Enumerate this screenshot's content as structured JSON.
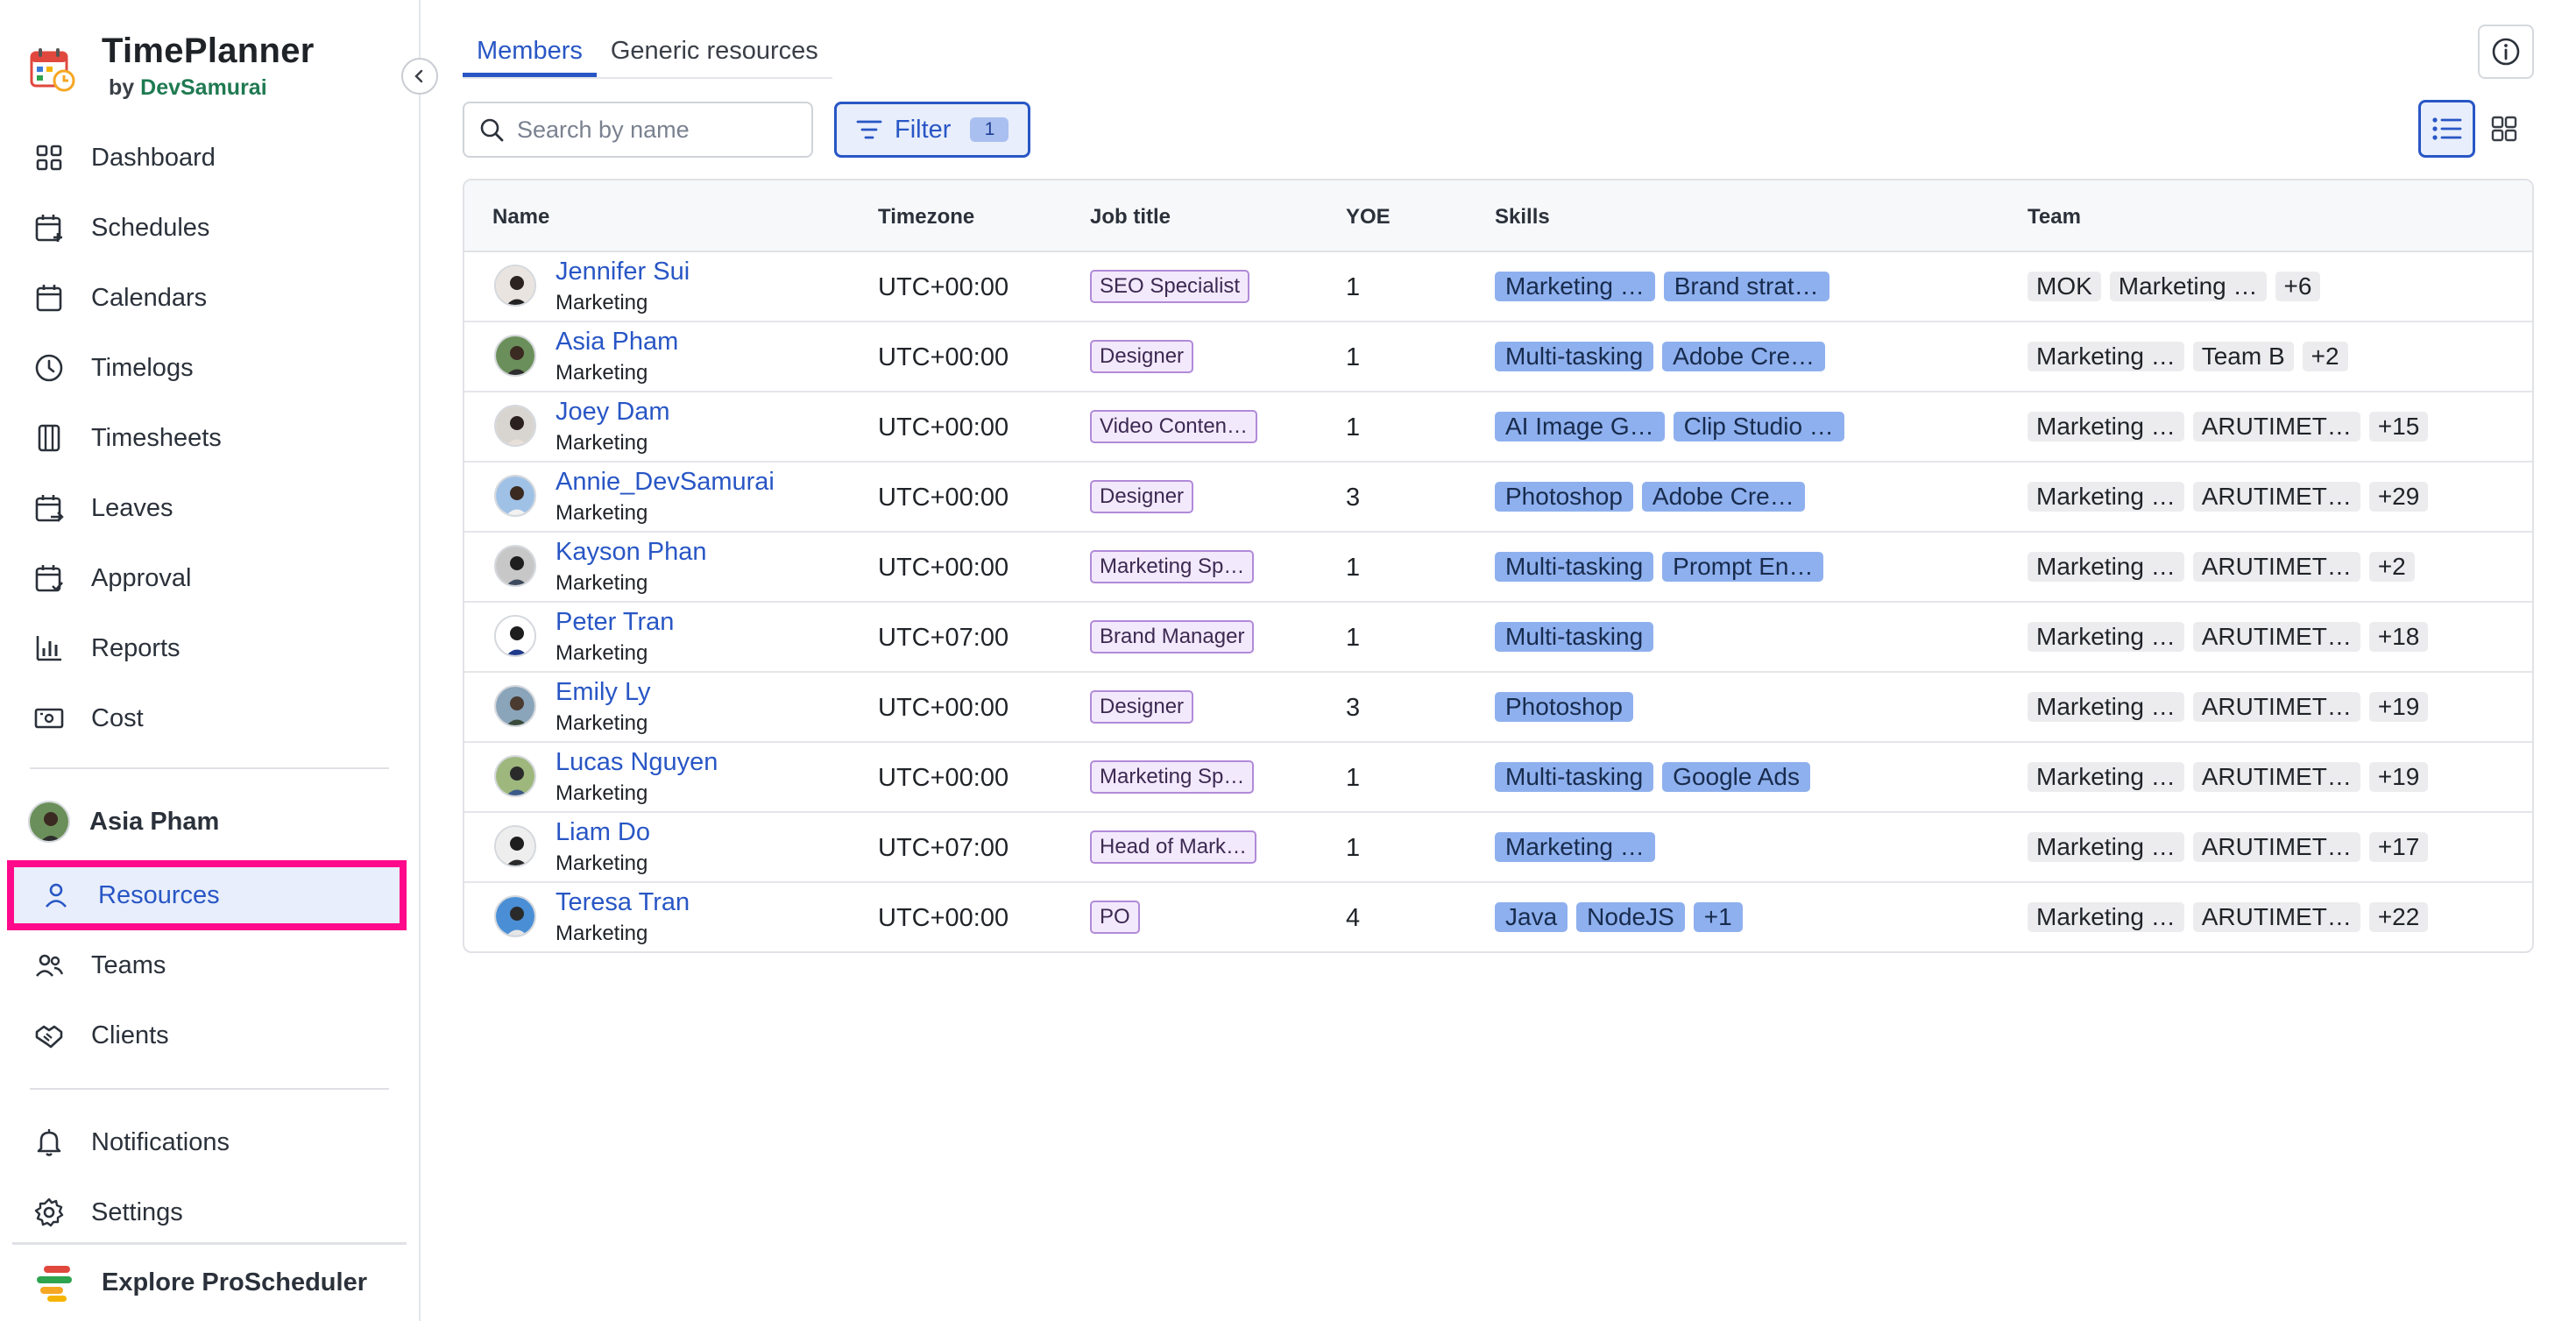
{
  "app": {
    "title": "TimePlanner",
    "by": "by",
    "vendor": "DevSamurai"
  },
  "sidebar": {
    "items": [
      {
        "label": "Dashboard",
        "icon": "dashboard-icon"
      },
      {
        "label": "Schedules",
        "icon": "calendar-plus-icon"
      },
      {
        "label": "Calendars",
        "icon": "calendar-icon"
      },
      {
        "label": "Timelogs",
        "icon": "clock-icon"
      },
      {
        "label": "Timesheets",
        "icon": "timesheet-icon"
      },
      {
        "label": "Leaves",
        "icon": "calendar-leave-icon"
      },
      {
        "label": "Approval",
        "icon": "calendar-check-icon"
      },
      {
        "label": "Reports",
        "icon": "bar-chart-icon"
      },
      {
        "label": "Cost",
        "icon": "money-icon"
      }
    ],
    "user_name": "Asia Pham",
    "items2": [
      {
        "label": "Resources",
        "icon": "person-icon",
        "active": true
      },
      {
        "label": "Teams",
        "icon": "people-icon"
      },
      {
        "label": "Clients",
        "icon": "handshake-icon"
      }
    ],
    "items3": [
      {
        "label": "Notifications",
        "icon": "bell-icon"
      },
      {
        "label": "Settings",
        "icon": "gear-icon"
      }
    ],
    "explore_label": "Explore ProScheduler"
  },
  "tabs": [
    {
      "label": "Members",
      "active": true
    },
    {
      "label": "Generic resources",
      "active": false
    }
  ],
  "search": {
    "placeholder": "Search by name"
  },
  "filter": {
    "label": "Filter",
    "count": "1"
  },
  "table": {
    "headers": {
      "name": "Name",
      "timezone": "Timezone",
      "job": "Job title",
      "yoe": "YOE",
      "skills": "Skills",
      "team": "Team"
    },
    "rows": [
      {
        "name": "Jennifer Sui",
        "dept": "Marketing",
        "tz": "UTC+00:00",
        "job": "SEO Specialist",
        "yoe": "1",
        "skills": [
          "Marketing …",
          "Brand strat…"
        ],
        "teams": [
          "MOK",
          "Marketing …",
          "+6"
        ]
      },
      {
        "name": "Asia Pham",
        "dept": "Marketing",
        "tz": "UTC+00:00",
        "job": "Designer",
        "yoe": "1",
        "skills": [
          "Multi-tasking",
          "Adobe Cre…"
        ],
        "teams": [
          "Marketing …",
          "Team B",
          "+2"
        ]
      },
      {
        "name": "Joey Dam",
        "dept": "Marketing",
        "tz": "UTC+00:00",
        "job": "Video Conten…",
        "yoe": "1",
        "skills": [
          "AI Image G…",
          "Clip Studio …"
        ],
        "teams": [
          "Marketing …",
          "ARUTIMET…",
          "+15"
        ]
      },
      {
        "name": "Annie_DevSamurai",
        "dept": "Marketing",
        "tz": "UTC+00:00",
        "job": "Designer",
        "yoe": "3",
        "skills": [
          "Photoshop",
          "Adobe Cre…"
        ],
        "teams": [
          "Marketing …",
          "ARUTIMET…",
          "+29"
        ]
      },
      {
        "name": "Kayson Phan",
        "dept": "Marketing",
        "tz": "UTC+00:00",
        "job": "Marketing Sp…",
        "yoe": "1",
        "skills": [
          "Multi-tasking",
          "Prompt En…"
        ],
        "teams": [
          "Marketing …",
          "ARUTIMET…",
          "+2"
        ]
      },
      {
        "name": "Peter Tran",
        "dept": "Marketing",
        "tz": "UTC+07:00",
        "job": "Brand Manager",
        "yoe": "1",
        "skills": [
          "Multi-tasking"
        ],
        "teams": [
          "Marketing …",
          "ARUTIMET…",
          "+18"
        ]
      },
      {
        "name": "Emily Ly",
        "dept": "Marketing",
        "tz": "UTC+00:00",
        "job": "Designer",
        "yoe": "3",
        "skills": [
          "Photoshop"
        ],
        "teams": [
          "Marketing …",
          "ARUTIMET…",
          "+19"
        ]
      },
      {
        "name": "Lucas Nguyen",
        "dept": "Marketing",
        "tz": "UTC+00:00",
        "job": "Marketing Sp…",
        "yoe": "1",
        "skills": [
          "Multi-tasking",
          "Google Ads"
        ],
        "teams": [
          "Marketing …",
          "ARUTIMET…",
          "+19"
        ]
      },
      {
        "name": "Liam Do",
        "dept": "Marketing",
        "tz": "UTC+07:00",
        "job": "Head of Mark…",
        "yoe": "1",
        "skills": [
          "Marketing …"
        ],
        "teams": [
          "Marketing …",
          "ARUTIMET…",
          "+17"
        ]
      },
      {
        "name": "Teresa Tran",
        "dept": "Marketing",
        "tz": "UTC+00:00",
        "job": "PO",
        "yoe": "4",
        "skills": [
          "Java",
          "NodeJS",
          "+1"
        ],
        "teams": [
          "Marketing …",
          "ARUTIMET…",
          "+22"
        ]
      }
    ]
  },
  "colors": {
    "accent": "#2856c5",
    "highlight_border": "#ff0a8a",
    "skill_tag": "#8fb0ee",
    "job_tag": "#f3e9fc"
  }
}
